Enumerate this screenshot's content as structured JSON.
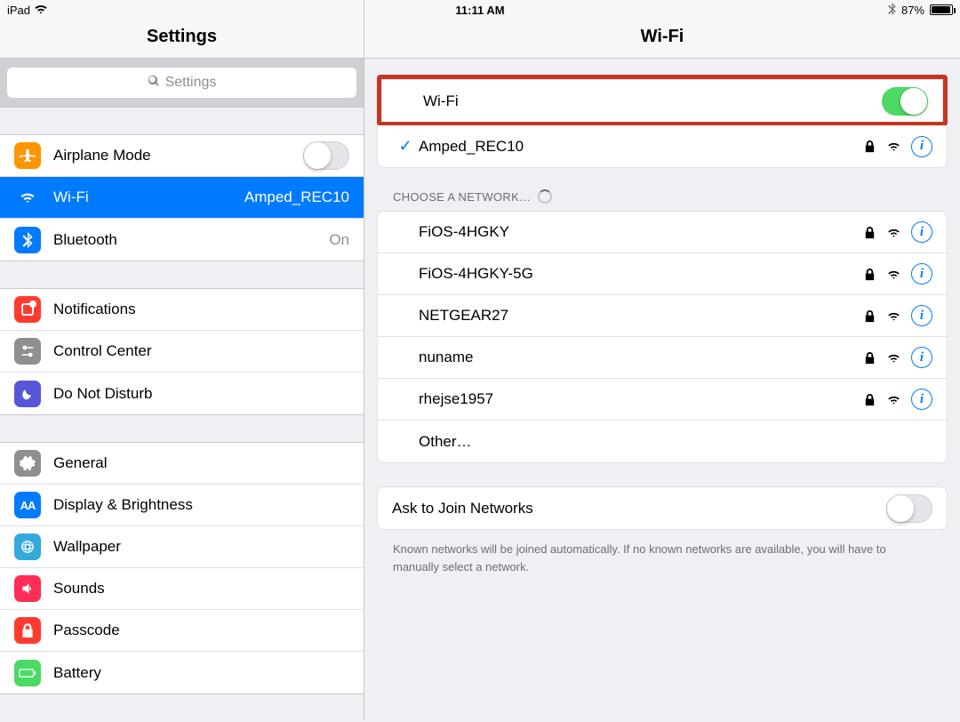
{
  "statusbar": {
    "device": "iPad",
    "time": "11:11 AM",
    "battery_pct": "87%",
    "battery_level": 0.87
  },
  "sidebar": {
    "title": "Settings",
    "search_placeholder": "Settings",
    "groups": [
      {
        "items": [
          {
            "key": "airplane",
            "label": "Airplane Mode",
            "icon": "airplane-icon",
            "color": "ic-orange",
            "accessory": "toggle-off"
          },
          {
            "key": "wifi",
            "label": "Wi-Fi",
            "icon": "wifi-icon",
            "color": "ic-blue",
            "detail": "Amped_REC10",
            "selected": true
          },
          {
            "key": "bluetooth",
            "label": "Bluetooth",
            "icon": "bluetooth-icon",
            "color": "ic-blue",
            "detail": "On"
          }
        ]
      },
      {
        "items": [
          {
            "key": "notifications",
            "label": "Notifications",
            "icon": "notifications-icon",
            "color": "ic-red"
          },
          {
            "key": "controlcenter",
            "label": "Control Center",
            "icon": "controlcenter-icon",
            "color": "ic-gray"
          },
          {
            "key": "donotdisturb",
            "label": "Do Not Disturb",
            "icon": "donotdisturb-icon",
            "color": "ic-purple"
          }
        ]
      },
      {
        "items": [
          {
            "key": "general",
            "label": "General",
            "icon": "general-icon",
            "color": "ic-gray"
          },
          {
            "key": "display",
            "label": "Display & Brightness",
            "icon": "display-icon",
            "color": "ic-blue"
          },
          {
            "key": "wallpaper",
            "label": "Wallpaper",
            "icon": "wallpaper-icon",
            "color": "ic-bluealt"
          },
          {
            "key": "sounds",
            "label": "Sounds",
            "icon": "sounds-icon",
            "color": "ic-pink"
          },
          {
            "key": "passcode",
            "label": "Passcode",
            "icon": "passcode-icon",
            "color": "ic-red"
          },
          {
            "key": "battery",
            "label": "Battery",
            "icon": "battery-icon",
            "color": "ic-green"
          }
        ]
      }
    ]
  },
  "right": {
    "title": "Wi-Fi",
    "wifi_toggle": {
      "label": "Wi-Fi",
      "on": true,
      "highlighted": true
    },
    "connected": {
      "name": "Amped_REC10",
      "locked": true
    },
    "choose_header": "CHOOSE A NETWORK…",
    "networks": [
      {
        "name": "FiOS-4HGKY",
        "locked": true
      },
      {
        "name": "FiOS-4HGKY-5G",
        "locked": true
      },
      {
        "name": "NETGEAR27",
        "locked": true
      },
      {
        "name": "nuname",
        "locked": true
      },
      {
        "name": "rhejse1957",
        "locked": true
      }
    ],
    "other_label": "Other…",
    "ask_to_join": {
      "label": "Ask to Join Networks",
      "on": false
    },
    "footnote": "Known networks will be joined automatically. If no known networks are available, you will have to manually select a network."
  }
}
